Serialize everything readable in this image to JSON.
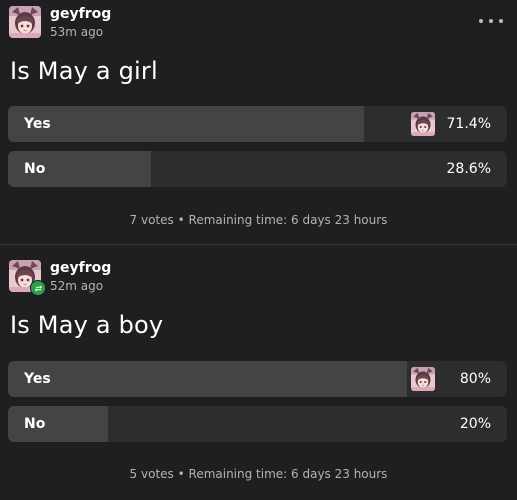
{
  "posts": [
    {
      "username": "geyfrog",
      "timestamp": "53m ago",
      "question": "Is May a girl",
      "options": [
        {
          "label": "Yes",
          "percent": "71.4%",
          "fraction": 0.714,
          "voted": true
        },
        {
          "label": "No",
          "percent": "28.6%",
          "fraction": 0.286,
          "voted": false
        }
      ],
      "votes": "7 votes",
      "separator": "•",
      "remaining": "Remaining time: 6 days 23 hours"
    },
    {
      "username": "geyfrog",
      "timestamp": "52m ago",
      "question": "Is May a boy",
      "options": [
        {
          "label": "Yes",
          "percent": "80%",
          "fraction": 0.8,
          "voted": true
        },
        {
          "label": "No",
          "percent": "20%",
          "fraction": 0.2,
          "voted": false
        }
      ],
      "votes": "5 votes",
      "separator": "•",
      "remaining": "Remaining time: 6 days 23 hours"
    }
  ],
  "icons": {
    "more": "more-horizontal-icon",
    "reblog": "reblog-icon"
  },
  "colors": {
    "background": "#1f1f21",
    "bar_track": "#2d2d30",
    "bar_fill": "#444447",
    "reblog_badge": "#2aa24a"
  }
}
